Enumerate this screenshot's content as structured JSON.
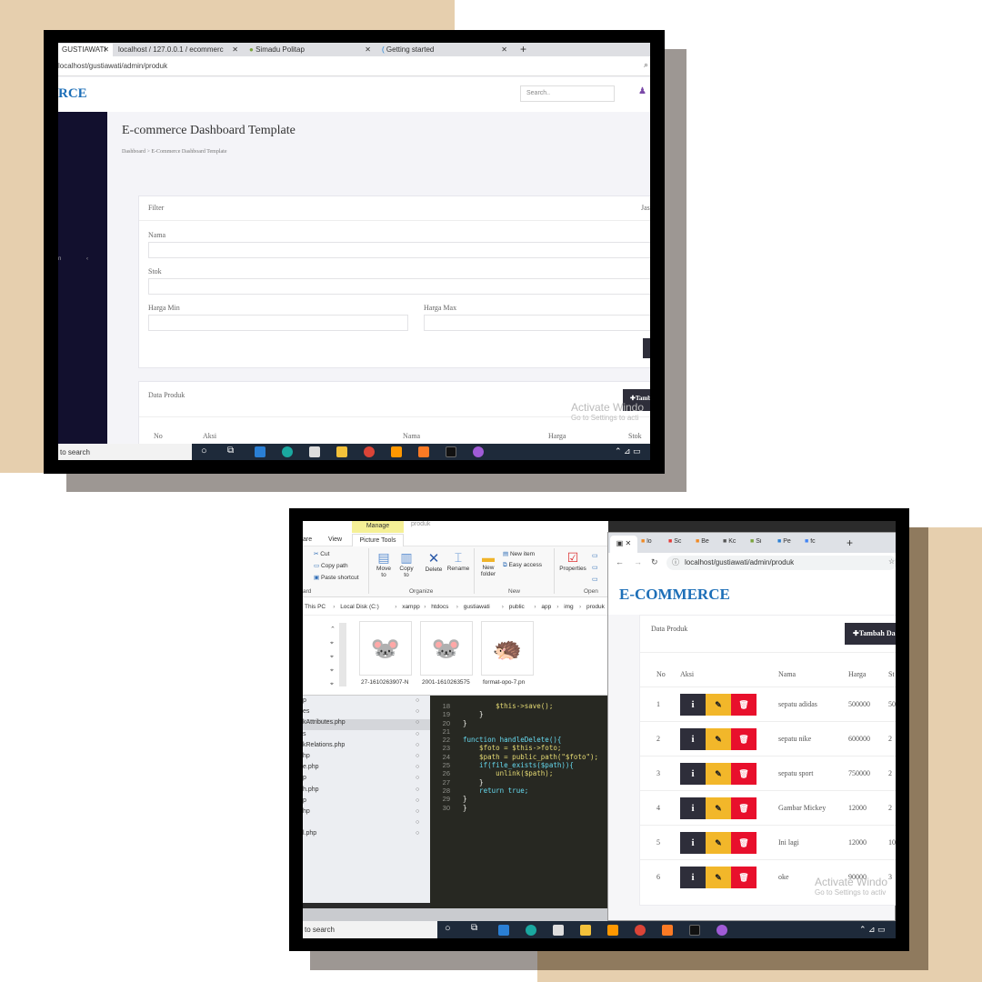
{
  "top": {
    "tabs": [
      {
        "label": "GUSTIAWATI",
        "active": true
      },
      {
        "label": "localhost / 127.0.0.1 / ecommerc"
      },
      {
        "label": "Simadu Politap"
      },
      {
        "label": "Getting started"
      }
    ],
    "new_tab": "+",
    "url": "localhost/gustiawati/admin/produk",
    "brand": "RCE",
    "search_placeholder": "Search..",
    "page_title": "E-commerce Dashboard Template",
    "breadcrumb": {
      "home": "Dashboard",
      "sep": ">",
      "current": "E-Commerce Dashboard Template"
    },
    "filter": {
      "title": "Filter",
      "right": "Jas",
      "nama": "Nama",
      "stok": "Stok",
      "harga_min": "Harga Min",
      "harga_max": "Harga Max"
    },
    "data_produk": {
      "title": "Data Produk",
      "add_button": "✚Tamb",
      "columns": [
        "No",
        "Aksi",
        "Nama",
        "Harga",
        "Stok"
      ]
    },
    "watermark": {
      "line1": "Activate Windo",
      "line2": "Go to Settings to acti"
    },
    "taskbar_search": "to search"
  },
  "bottom": {
    "explorer": {
      "context_tab": "Manage",
      "context_tab_right": "produk",
      "tabs": [
        "are",
        "View",
        "Picture Tools"
      ],
      "clipboard": {
        "cut": "Cut",
        "copy_path": "Copy path",
        "paste_shortcut": "Paste shortcut",
        "group": "ard"
      },
      "organize": {
        "move": "Move to",
        "copy": "Copy to",
        "delete": "Delete",
        "rename": "Rename",
        "group": "Organize"
      },
      "new": {
        "new_folder": "New folder",
        "new_item": "New item",
        "easy_access": "Easy access",
        "group": "New"
      },
      "open": {
        "properties": "Properties",
        "group": "Open"
      },
      "path": [
        "This PC",
        "Local Disk (C:)",
        "xampp",
        "htdocs",
        "gustiawati",
        "public",
        "app",
        "img",
        "produk"
      ],
      "files": [
        "27-1610263907-N",
        "2001-1610263575",
        "format-opo-7.pn"
      ]
    },
    "editor": {
      "file_items": [
        "p",
        "es",
        "kAttributes.php",
        "s",
        "kRelations.php",
        "hp",
        "e.php",
        "p",
        "h.php",
        "p",
        "hp",
        "",
        "l.php"
      ],
      "line_numbers": [
        "18",
        "19",
        "20",
        "21",
        "22",
        "23",
        "24",
        "25",
        "26",
        "27",
        "28",
        "29",
        "30"
      ],
      "code_lines": [
        "        $this->save();",
        "    }",
        "}",
        "",
        "function handleDelete(){",
        "    $foto = $this->foto;",
        "    $path = public_path(\"$foto\");",
        "    if(file_exists($path)){",
        "        unlink($path);",
        "    }",
        "    return true;",
        "}",
        "}"
      ]
    },
    "browser": {
      "tabs": [
        "lo",
        "Sc",
        "Be",
        "Kc",
        "Si",
        "Pe",
        "fc"
      ],
      "url": "localhost/gustiawati/admin/produk",
      "brand": "E-COMMERCE",
      "card_title": "Data Produk",
      "add_button": "✚Tambah Da",
      "columns": [
        "No",
        "Aksi",
        "Nama",
        "Harga",
        "St"
      ],
      "rows": [
        {
          "no": "1",
          "nama": "sepatu adidas",
          "harga": "500000",
          "stok": "50"
        },
        {
          "no": "2",
          "nama": "sepatu nike",
          "harga": "600000",
          "stok": "2"
        },
        {
          "no": "3",
          "nama": "sepatu sport",
          "harga": "750000",
          "stok": "2"
        },
        {
          "no": "4",
          "nama": "Gambar Mickey",
          "harga": "12000",
          "stok": "2"
        },
        {
          "no": "5",
          "nama": "Ini lagi",
          "harga": "12000",
          "stok": "10"
        },
        {
          "no": "6",
          "nama": "oke",
          "harga": "90000",
          "stok": "3"
        }
      ],
      "watermark": {
        "line1": "Activate Windo",
        "line2": "Go to Settings to activ"
      }
    },
    "taskbar_search": "to search"
  },
  "colors": {
    "tan": "#e6cfae",
    "gray": "#9d9793",
    "brown": "#8f7a5e",
    "brand": "#1d6fb8",
    "sidebar": "#12102e"
  }
}
